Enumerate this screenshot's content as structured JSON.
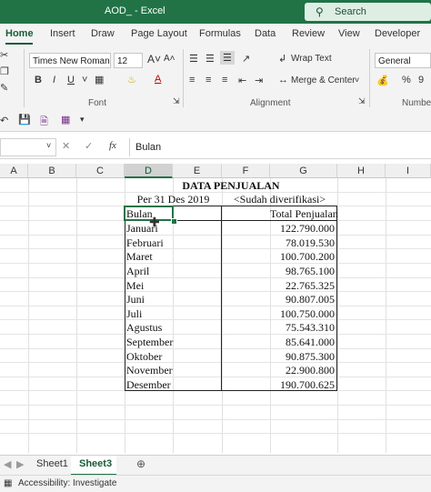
{
  "titlebar": {
    "title": "AOD_  -  Excel",
    "search_placeholder": "Search"
  },
  "ribbon_tabs": [
    "Home",
    "Insert",
    "Draw",
    "Page Layout",
    "Formulas",
    "Data",
    "Review",
    "View",
    "Developer"
  ],
  "ribbon": {
    "font_name": "Times New Roman",
    "font_size": "12",
    "number_format": "General",
    "wrap_text": "Wrap Text",
    "merge_center": "Merge & Center",
    "group_font": "Font",
    "group_alignment": "Alignment",
    "group_number": "Number"
  },
  "formula_bar": {
    "fx": "fx",
    "content": "Bulan"
  },
  "columns": [
    "A",
    "B",
    "C",
    "D",
    "E",
    "F",
    "G",
    "H",
    "I"
  ],
  "sheet": {
    "title": "DATA PENJUALAN",
    "date": "Per 31 Des 2019",
    "verified": "<Sudah diverifikasi>",
    "header_month": "Bulan",
    "header_total": "Total Penjualan",
    "rows": [
      {
        "month": "Januari",
        "total": "122.790.000"
      },
      {
        "month": "Februari",
        "total": "78.019.530"
      },
      {
        "month": "Maret",
        "total": "100.700.200"
      },
      {
        "month": "April",
        "total": "98.765.100"
      },
      {
        "month": "Mei",
        "total": "22.765.325"
      },
      {
        "month": "Juni",
        "total": "90.807.005"
      },
      {
        "month": "Juli",
        "total": "100.750.000"
      },
      {
        "month": "Agustus",
        "total": "75.543.310"
      },
      {
        "month": "September",
        "total": "85.641.000"
      },
      {
        "month": "Oktober",
        "total": "90.875.300"
      },
      {
        "month": "November",
        "total": "22.900.800"
      },
      {
        "month": "Desember",
        "total": "190.700.625"
      }
    ]
  },
  "sheet_tabs": [
    "Sheet1",
    "Sheet3"
  ],
  "status": {
    "accessibility": "Accessibility: Investigate"
  },
  "colors": {
    "excel_green": "#217346",
    "tab_green": "#185c37"
  }
}
